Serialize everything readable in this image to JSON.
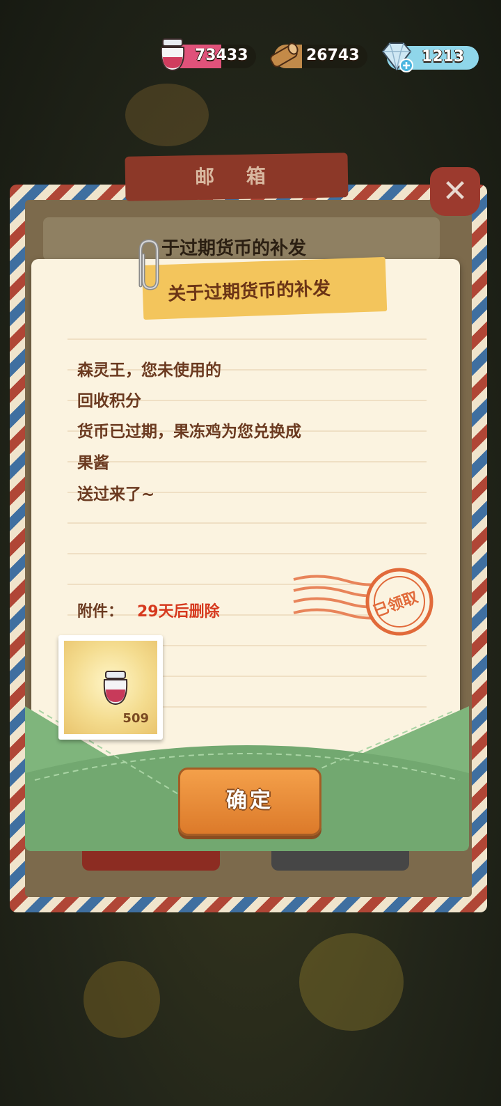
{
  "currencies": {
    "jam": {
      "value": "73433",
      "icon": "jam-jar-icon",
      "color": "#e0527a"
    },
    "wood": {
      "value": "26743",
      "icon": "wood-log-icon",
      "color": "#c08a4a"
    },
    "gem": {
      "value": "1213",
      "icon": "diamond-icon",
      "color": "#7fd0e8"
    }
  },
  "mailbox": {
    "title": "邮 箱",
    "close_label": "✕",
    "list_item_title": "于过期货币的补发"
  },
  "letter": {
    "title": "关于过期货币的补发",
    "lines": [
      "森灵王，您未使用的",
      "回收积分",
      "货币已过期，果冻鸡为您兑换成",
      "果酱",
      "送过来了~"
    ],
    "attachment_label": "附件：",
    "attachment_expiry": "29天后删除",
    "stamp_text": "已领取",
    "attachment_item": {
      "icon": "jam-jar-icon",
      "count": "509"
    }
  },
  "buttons": {
    "confirm": "确定"
  },
  "colors": {
    "paper": "#fbf3e0",
    "text_brown": "#6b3a20",
    "warning_red": "#d6391e",
    "envelope_green": "#7fb57c",
    "button_orange": "#e68a34",
    "tape_yellow": "#f3c55c"
  }
}
